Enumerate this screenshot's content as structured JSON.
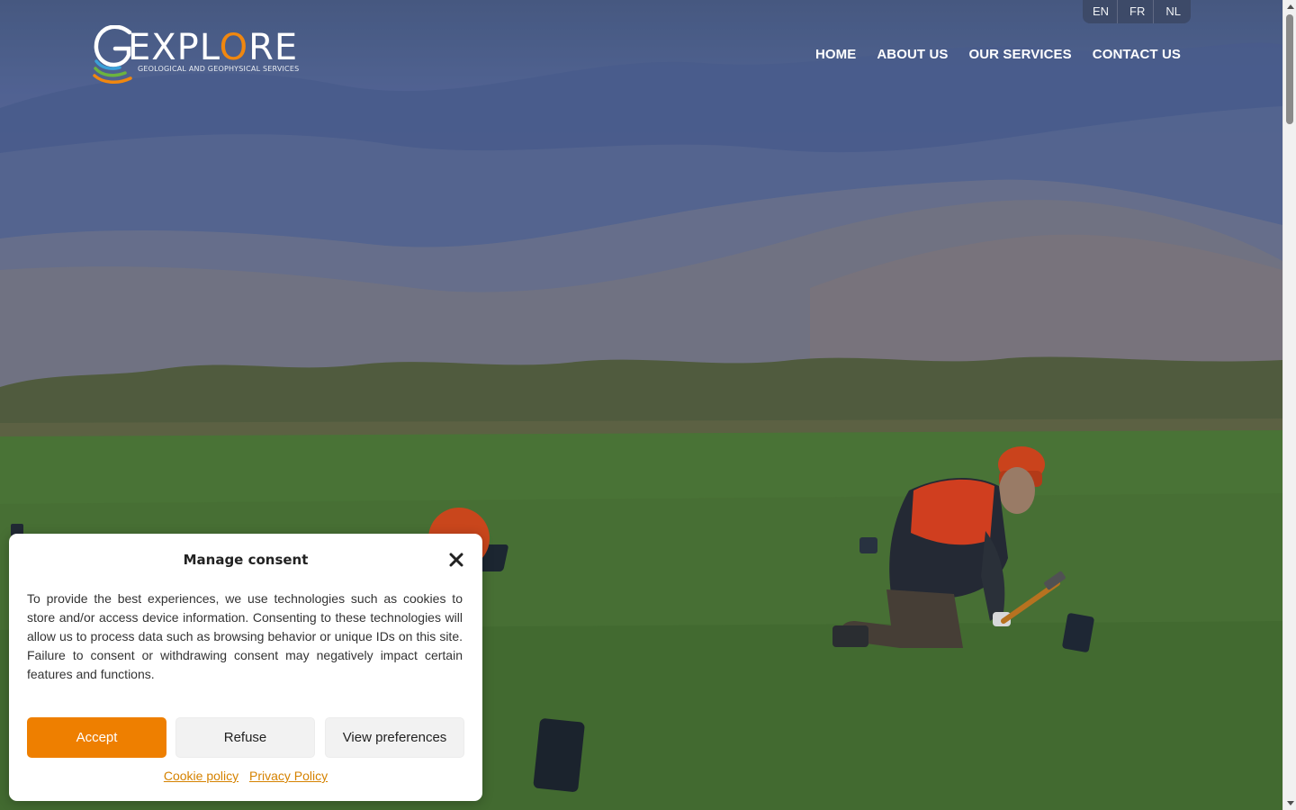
{
  "language_switcher": {
    "items": [
      "EN",
      "FR",
      "NL"
    ]
  },
  "logo": {
    "word_prefix": "EXPL",
    "word_o": "O",
    "word_suffix": "RE",
    "tagline": "GEOLOGICAL AND GEOPHYSICAL SERVICES"
  },
  "nav": {
    "items": [
      "HOME",
      "ABOUT US",
      "OUR SERVICES",
      "CONTACT US"
    ]
  },
  "consent": {
    "title": "Manage consent",
    "body": "To provide the best experiences, we use technologies such as cookies to store and/or access device information. Consenting to these technologies will allow us to process data such as browsing behavior or unique IDs on this site. Failure to consent or withdrawing consent may negatively impact certain features and functions.",
    "accept_label": "Accept",
    "refuse_label": "Refuse",
    "preferences_label": "View preferences",
    "cookie_policy_label": "Cookie policy",
    "privacy_policy_label": "Privacy Policy"
  },
  "colors": {
    "accent": "#ee7f00",
    "link": "#d58200",
    "logo_orange": "#f0870f",
    "logo_green": "#6cb33f",
    "logo_blue": "#3aa0d8"
  }
}
